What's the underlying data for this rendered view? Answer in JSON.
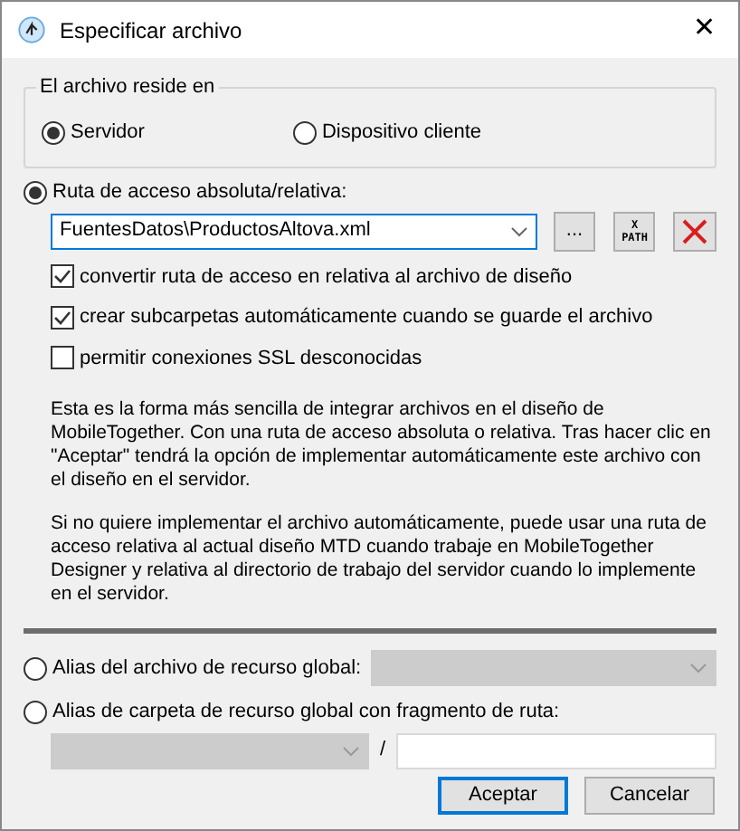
{
  "window": {
    "title": "Especificar archivo",
    "close": "✕"
  },
  "location_group": {
    "title": "El archivo reside en",
    "options": [
      {
        "label": "Servidor",
        "selected": true
      },
      {
        "label": "Dispositivo cliente",
        "selected": false
      }
    ]
  },
  "path_option": {
    "label": "Ruta de acceso absoluta/relativa:",
    "selected": true,
    "value": "FuentesDatos\\ProductosAltova.xml",
    "browse": "...",
    "xpath_top": "X",
    "xpath_bottom": "PATH"
  },
  "checkboxes": [
    {
      "label": "convertir ruta de acceso en relativa al archivo de diseño",
      "checked": true
    },
    {
      "label": "crear subcarpetas automáticamente cuando se guarde el archivo",
      "checked": true
    },
    {
      "label": "permitir conexiones SSL desconocidas",
      "checked": false
    }
  ],
  "paragraphs": [
    "Esta es la forma más sencilla de integrar archivos en el diseño de MobileTogether. Con una ruta de acceso absoluta o relativa. Tras hacer clic en \"Aceptar\" tendrá la opción de implementar automáticamente este archivo con el diseño en el servidor.",
    "Si no quiere implementar el archivo automáticamente, puede usar una ruta de acceso relativa al actual diseño MTD cuando trabaje en MobileTogether Designer y relativa al directorio de trabajo del servidor cuando lo implemente en el servidor."
  ],
  "global_file_option": {
    "label": "Alias del archivo de recurso global:",
    "selected": false,
    "disabled": true
  },
  "global_folder_option": {
    "label": "Alias de carpeta de recurso global con fragmento de ruta:",
    "selected": false,
    "disabled": true,
    "separator": "/"
  },
  "buttons": [
    {
      "label": "Aceptar",
      "default": true
    },
    {
      "label": "Cancelar",
      "default": false
    }
  ]
}
